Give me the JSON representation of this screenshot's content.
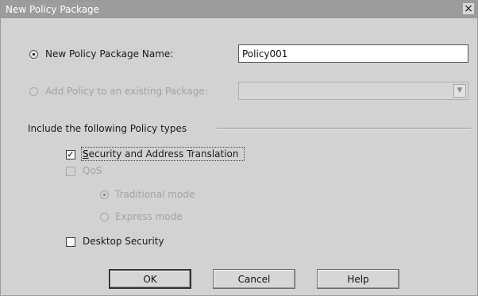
{
  "window": {
    "title": "New Policy Package",
    "close_glyph": "×"
  },
  "options": {
    "new_package_label": "New Policy Package Name:",
    "new_package_value": "Policy001",
    "add_to_existing_label": "Add Policy to an existing Package:"
  },
  "policy_types": {
    "heading": "Include the following Policy types",
    "security_label": "Security and Address Translation",
    "qos_label": "QoS",
    "traditional_label": "Traditional mode",
    "express_label": "Express mode",
    "desktop_label": "Desktop Security"
  },
  "buttons": {
    "ok": "OK",
    "cancel": "Cancel",
    "help": "Help"
  }
}
